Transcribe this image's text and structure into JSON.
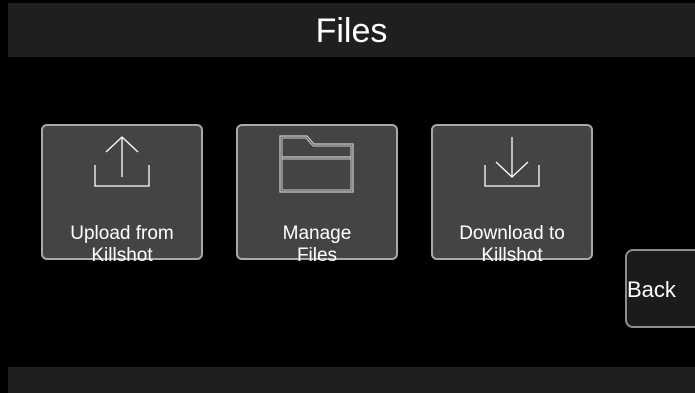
{
  "header": {
    "title": "Files"
  },
  "tiles": [
    {
      "label_line1": "Upload from",
      "label_line2": "Killshot",
      "icon": "upload-icon"
    },
    {
      "label_line1": "Manage",
      "label_line2": "Files",
      "icon": "folder-icon"
    },
    {
      "label_line1": "Download to",
      "label_line2": "Killshot",
      "icon": "download-icon"
    }
  ],
  "back_button": {
    "label": "Back"
  },
  "colors": {
    "background": "#000000",
    "bar": "#1f1f1f",
    "tile_fill": "#444444",
    "tile_border": "#a9a9a9",
    "text": "#ffffff"
  }
}
